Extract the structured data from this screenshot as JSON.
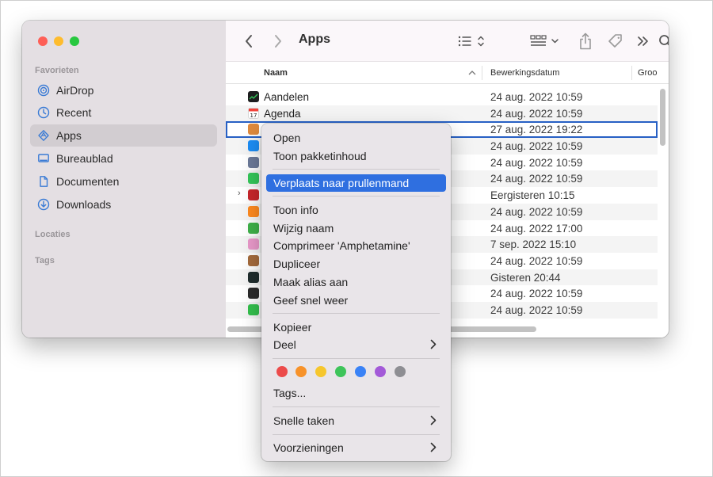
{
  "sidebar": {
    "sections": {
      "favorites": "Favorieten",
      "locations": "Locaties",
      "tags": "Tags"
    },
    "items": [
      {
        "label": "AirDrop",
        "icon": "airdrop-icon"
      },
      {
        "label": "Recent",
        "icon": "clock-icon"
      },
      {
        "label": "Apps",
        "icon": "apps-icon",
        "active": true
      },
      {
        "label": "Bureaublad",
        "icon": "desktop-icon"
      },
      {
        "label": "Documenten",
        "icon": "document-icon"
      },
      {
        "label": "Downloads",
        "icon": "download-icon"
      }
    ]
  },
  "toolbar": {
    "title": "Apps"
  },
  "columns": {
    "name": "Naam",
    "modified": "Bewerkingsdatum",
    "size": "Groo"
  },
  "rows": [
    {
      "name": "Aandelen",
      "date": "24 aug. 2022 10:59",
      "icon_color": "#1d1d1f"
    },
    {
      "name": "Agenda",
      "date": "24 aug. 2022 10:59",
      "icon_color": "#ffffff"
    },
    {
      "name": "",
      "date": "27 aug. 2022 19:22",
      "icon_color": "#e08a3c",
      "selected": true
    },
    {
      "name": "",
      "date": "24 aug. 2022 10:59",
      "icon_color": "#1c8ef6"
    },
    {
      "name": "",
      "date": "24 aug. 2022 10:59",
      "icon_color": "#6c7a99"
    },
    {
      "name": "",
      "date": "24 aug. 2022 10:59",
      "icon_color": "#34c759"
    },
    {
      "name": "",
      "date": "Eergisteren 10:15",
      "icon_color": "#c8262b",
      "disclosure": true
    },
    {
      "name": "",
      "date": "24 aug. 2022 10:59",
      "icon_color": "#ff8a1f"
    },
    {
      "name": "",
      "date": "24 aug. 2022 17:00",
      "icon_color": "#3fb24a"
    },
    {
      "name": "",
      "date": "7 sep. 2022 15:10",
      "icon_color": "#ea9acb"
    },
    {
      "name": "",
      "date": "24 aug. 2022 10:59",
      "icon_color": "#a56b3c"
    },
    {
      "name": "",
      "date": "Gisteren 20:44",
      "icon_color": "#1f2d2d"
    },
    {
      "name": "",
      "date": "24 aug. 2022 10:59",
      "icon_color": "#2a2a2a"
    },
    {
      "name": "",
      "date": "24 aug. 2022 10:59",
      "icon_color": "#33c04c"
    }
  ],
  "context_menu": {
    "open": "Open",
    "show_package": "Toon pakketinhoud",
    "move_to_trash": "Verplaats naar prullenmand",
    "get_info": "Toon info",
    "rename": "Wijzig naam",
    "compress": "Comprimeer 'Amphetamine'",
    "duplicate": "Dupliceer",
    "make_alias": "Maak alias aan",
    "quick_look": "Geef snel weer",
    "copy": "Kopieer",
    "share": "Deel",
    "tags": "Tags...",
    "quick_actions": "Snelle taken",
    "services": "Voorzieningen",
    "tag_colors": [
      "#ec4b4b",
      "#f7922a",
      "#f6c62d",
      "#3ec45a",
      "#3a82f6",
      "#a35ad8",
      "#8e8e93"
    ]
  }
}
